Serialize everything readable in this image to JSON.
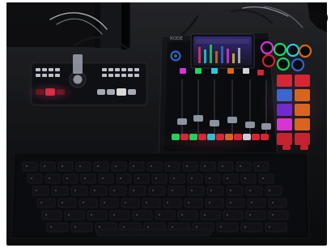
{
  "scene": {
    "left_device": {
      "brand": ""
    },
    "mixer": {
      "brand": "RODE"
    },
    "colors": {
      "desk": "#141518",
      "keyboard": "#0b0c0e",
      "red": "#ff2a3a",
      "green": "#22ff6a",
      "cyan": "#2cf0ff",
      "blue": "#3b7bff",
      "magenta": "#ff3cff",
      "orange": "#ff7a1a",
      "white": "#f5f7ff"
    }
  }
}
